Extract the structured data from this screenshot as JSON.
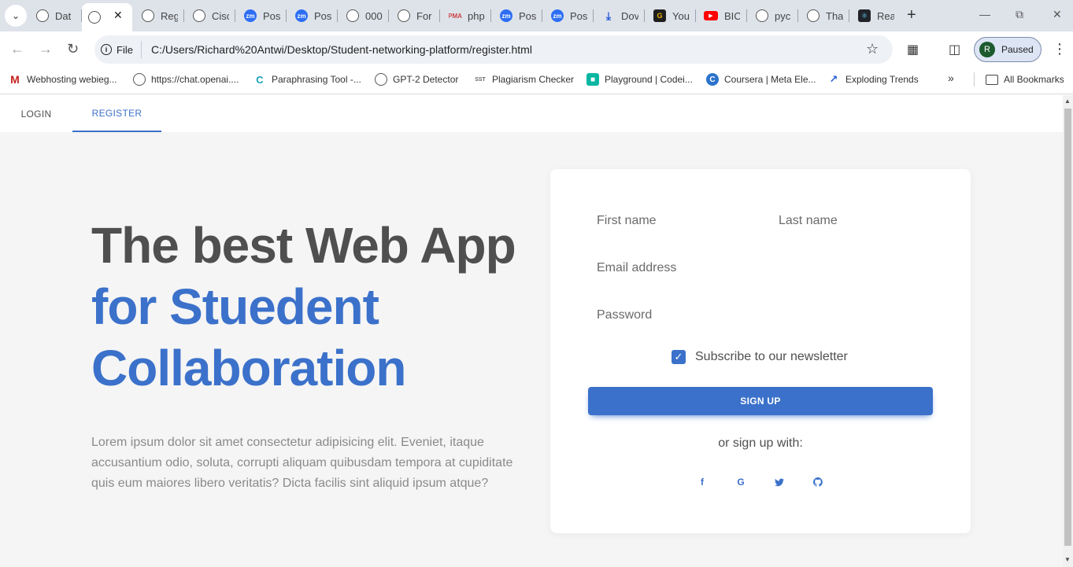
{
  "browser": {
    "tabs": [
      {
        "label": "Dat",
        "icon": "globe-icon"
      },
      {
        "label": "",
        "icon": "globe-icon",
        "active": true
      },
      {
        "label": "Reg",
        "icon": "globe-icon"
      },
      {
        "label": "Cisc",
        "icon": "globe-icon"
      },
      {
        "label": "Pos",
        "icon": "zoom-icon"
      },
      {
        "label": "Pos",
        "icon": "zoom-icon"
      },
      {
        "label": "000",
        "icon": "globe-icon"
      },
      {
        "label": "For",
        "icon": "globe-icon"
      },
      {
        "label": "php",
        "icon": "phpmyadmin-icon"
      },
      {
        "label": "Pos",
        "icon": "zoom-icon"
      },
      {
        "label": "Pos",
        "icon": "zoom-icon"
      },
      {
        "label": "Dov",
        "icon": "download-icon"
      },
      {
        "label": "You",
        "icon": "g-icon"
      },
      {
        "label": "BIC",
        "icon": "youtube-icon"
      },
      {
        "label": "pyc",
        "icon": "globe-icon"
      },
      {
        "label": "Tha",
        "icon": "globe-icon"
      },
      {
        "label": "Rea",
        "icon": "react-icon"
      }
    ],
    "address": {
      "scheme_label": "File",
      "url": "C:/Users/Richard%20Antwi/Desktop/Student-networking-platform/register.html"
    },
    "profile": {
      "initial": "R",
      "status": "Paused"
    },
    "bookmarks": [
      {
        "label": "Webhosting webieg...",
        "icon": "gmail-icon"
      },
      {
        "label": "https://chat.openai....",
        "icon": "openai-icon"
      },
      {
        "label": "Paraphrasing Tool -...",
        "icon": "paraphrase-icon"
      },
      {
        "label": "GPT-2  Detector",
        "icon": "globe-icon"
      },
      {
        "label": "Plagiarism Checker",
        "icon": "sst-icon"
      },
      {
        "label": "Playground | Codei...",
        "icon": "codeium-icon"
      },
      {
        "label": "Coursera | Meta Ele...",
        "icon": "coursera-icon"
      },
      {
        "label": "Exploding Trends",
        "icon": "trend-icon"
      }
    ],
    "all_bookmarks_label": "All Bookmarks"
  },
  "nav": {
    "tabs": [
      {
        "label": "LOGIN",
        "active": false
      },
      {
        "label": "REGISTER",
        "active": true
      }
    ]
  },
  "hero": {
    "line1": "The best Web App",
    "line2": "for Stuedent",
    "line3": "Collaboration",
    "body": "Lorem ipsum dolor sit amet consectetur adipisicing elit. Eveniet, itaque accusantium odio, soluta, corrupti aliquam quibusdam tempora at cupiditate quis eum maiores libero veritatis? Dicta facilis sint aliquid ipsum atque?"
  },
  "form": {
    "first_name_placeholder": "First name",
    "last_name_placeholder": "Last name",
    "email_placeholder": "Email address",
    "password_placeholder": "Password",
    "newsletter_label": "Subscribe to our newsletter",
    "newsletter_checked": true,
    "submit_label": "SIGN UP",
    "social_prompt": "or sign up with:",
    "social": [
      "facebook-icon",
      "google-icon",
      "twitter-icon",
      "github-icon"
    ]
  },
  "colors": {
    "primary": "#3b71ca",
    "heading_dark": "#4f4f4f",
    "page_bg": "#f5f5f5"
  }
}
